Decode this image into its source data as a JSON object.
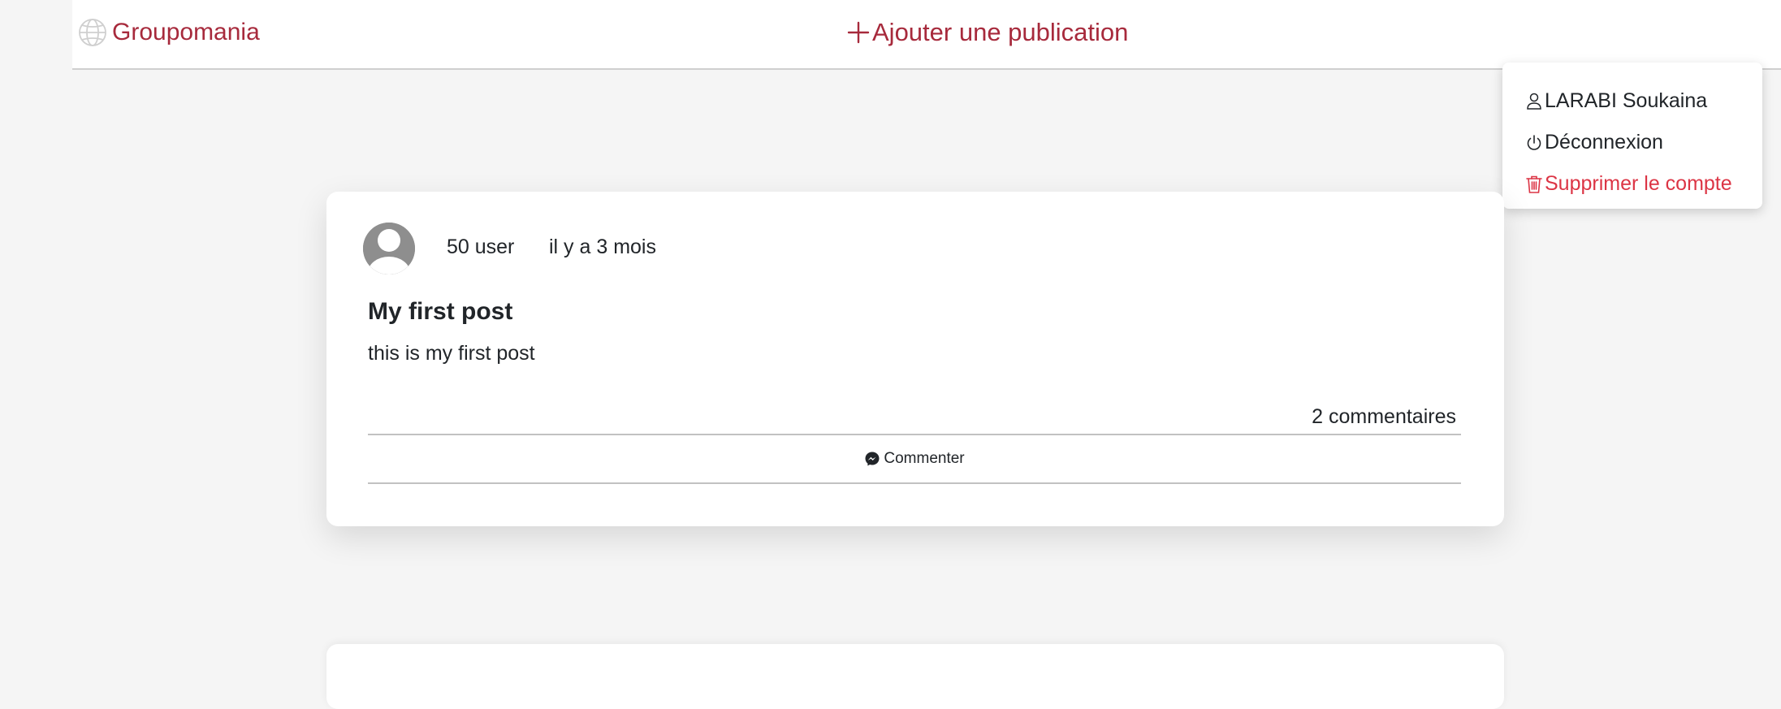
{
  "navbar": {
    "brand_label": "Groupomania",
    "brand_icon": "globe-icon",
    "add_post_label": "Ajouter une publication",
    "add_post_icon": "plus-icon",
    "accent_color": "#a72a3c"
  },
  "dropdown": {
    "items": [
      {
        "label": "LARABI Soukaina",
        "icon": "person-icon"
      },
      {
        "label": "Déconnexion",
        "icon": "power-icon"
      },
      {
        "label": "Supprimer le compte",
        "icon": "trash-icon",
        "color": "#dc3545"
      }
    ]
  },
  "posts": [
    {
      "author": "50 user",
      "time": "il y a 3 mois",
      "title": "My first post",
      "body": "this is my first post",
      "comment_count_label": "2 commentaires",
      "comment_button_label": "Commenter",
      "comment_button_icon": "messenger-icon"
    }
  ]
}
